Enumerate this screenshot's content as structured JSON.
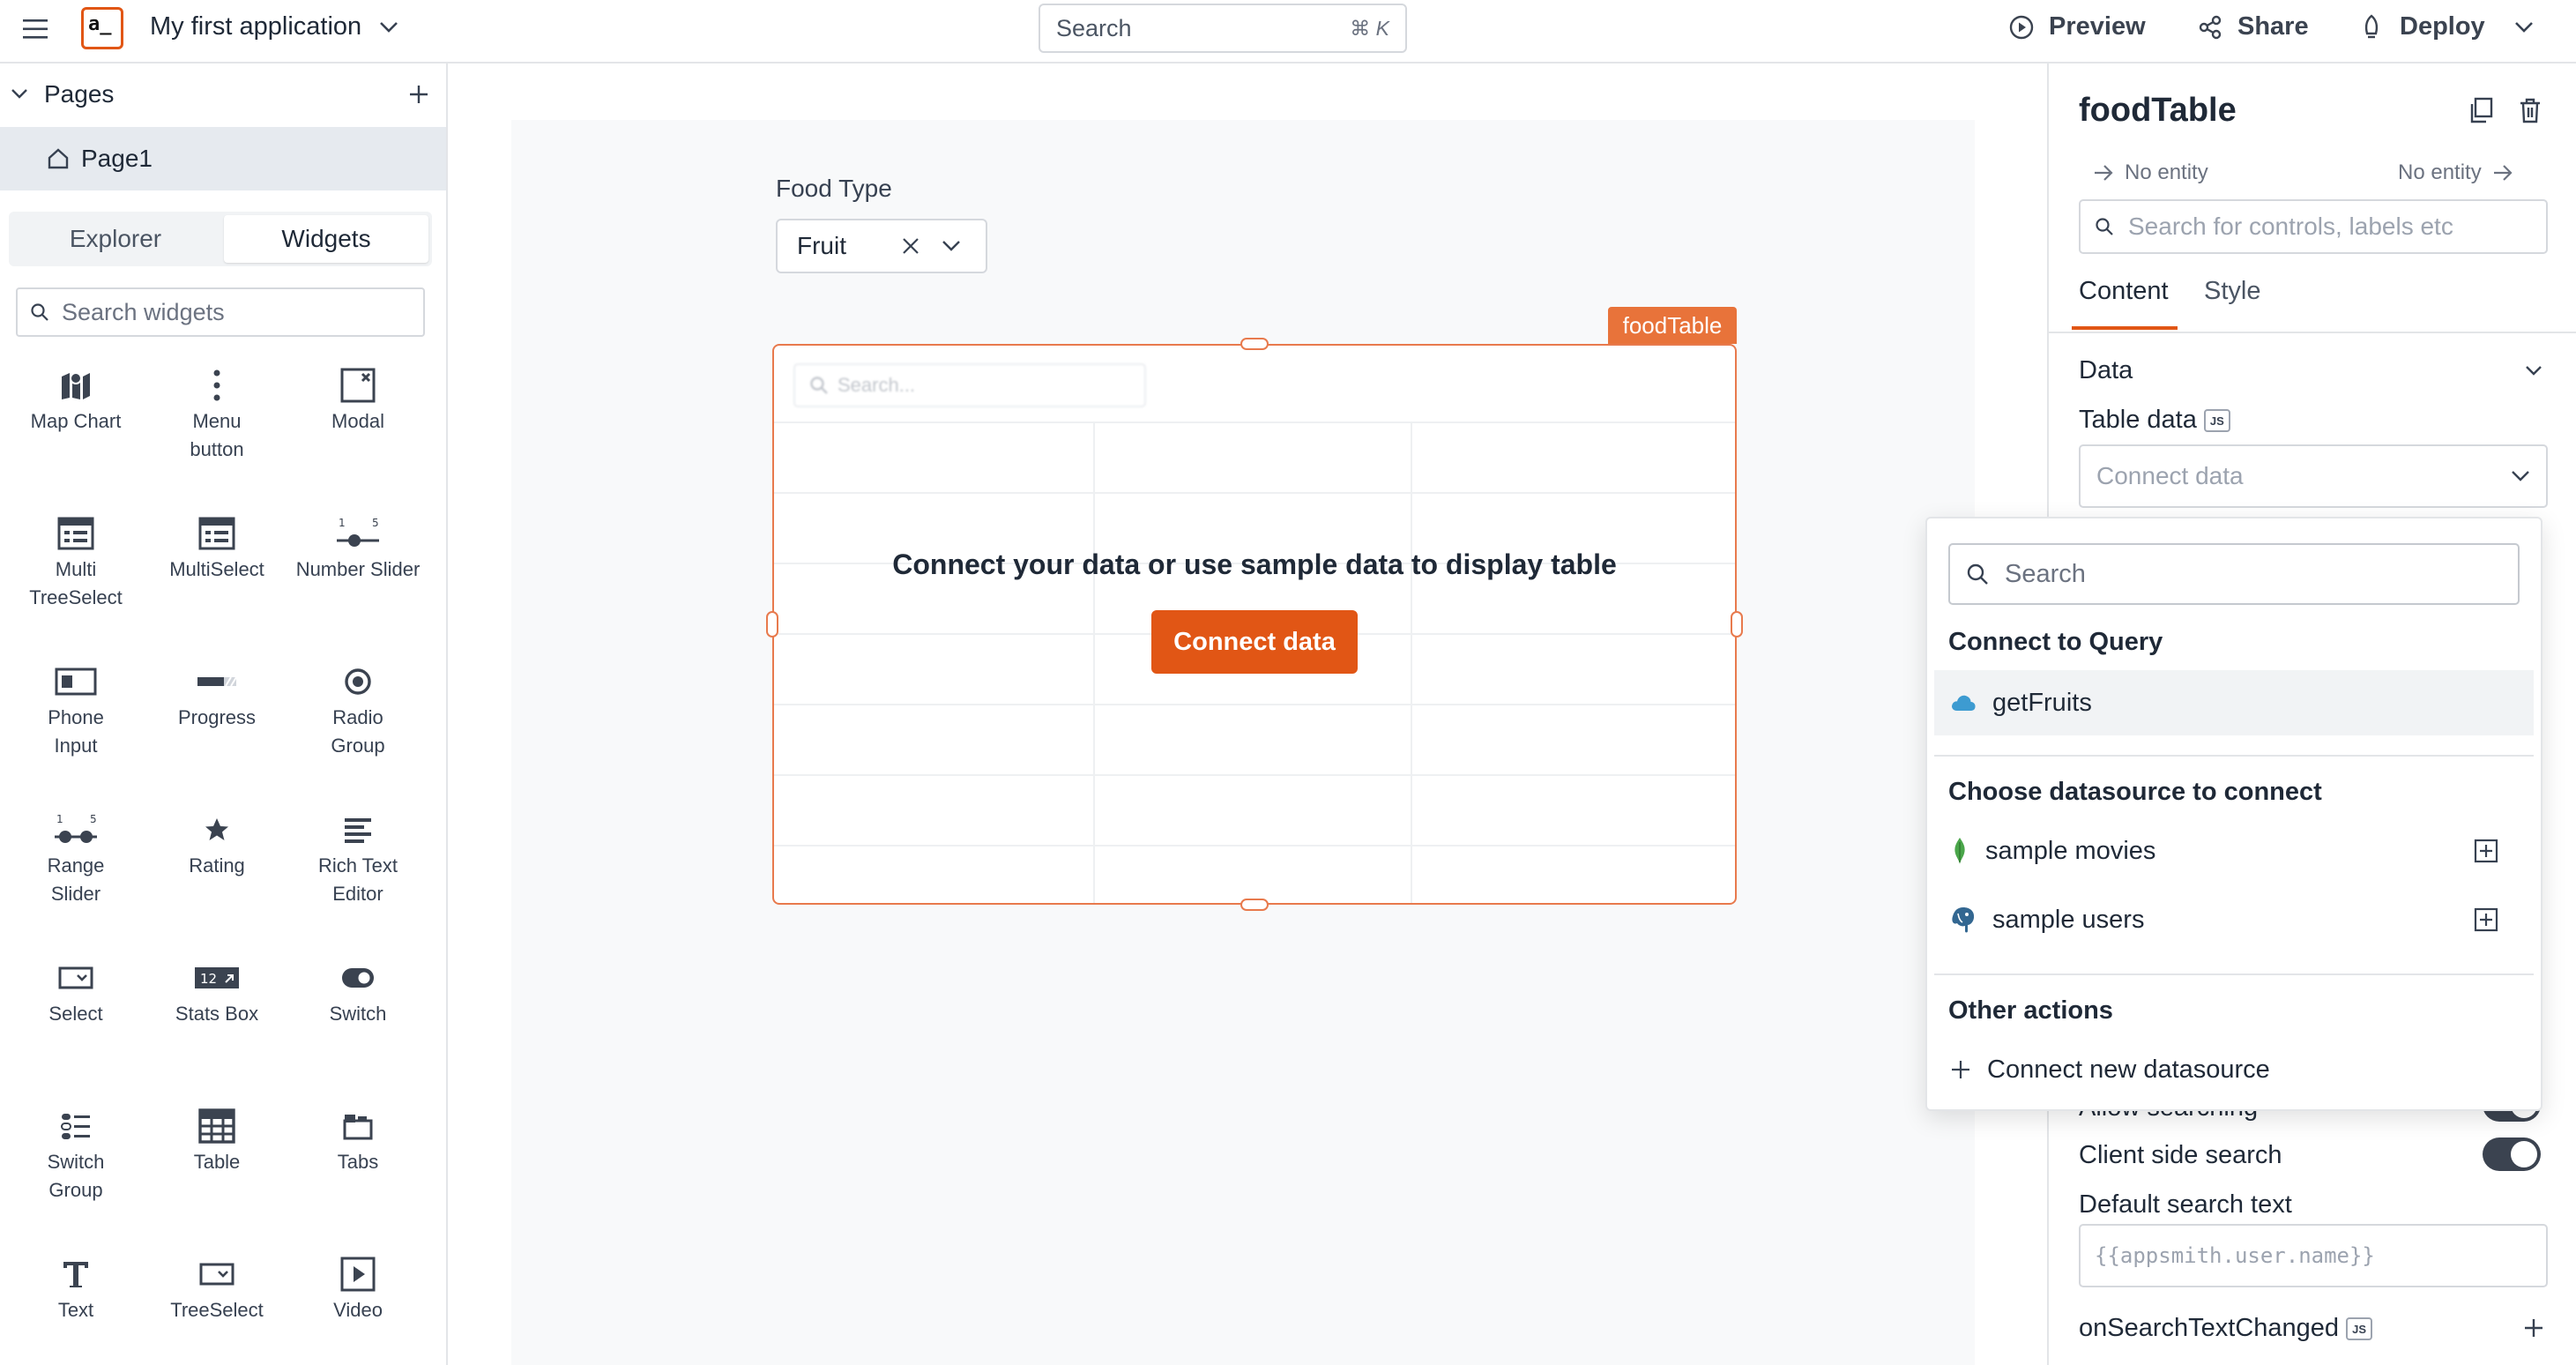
{
  "header": {
    "app_name": "My first application",
    "search_placeholder": "Search",
    "search_shortcut": "⌘ K",
    "preview_label": "Preview",
    "share_label": "Share",
    "deploy_label": "Deploy",
    "logo_text": "a_"
  },
  "sidebar": {
    "pages_title": "Pages",
    "pages": [
      {
        "label": "Page1"
      }
    ],
    "tabs": [
      {
        "label": "Explorer"
      },
      {
        "label": "Widgets"
      }
    ],
    "active_tab": "Widgets",
    "search_placeholder": "Search widgets",
    "widgets": [
      {
        "label": "Map Chart",
        "icon": "map-chart-icon"
      },
      {
        "label": "Menu button",
        "icon": "menu-button-icon"
      },
      {
        "label": "Modal",
        "icon": "modal-icon"
      },
      {
        "label": "Multi TreeSelect",
        "icon": "multi-treeselect-icon"
      },
      {
        "label": "MultiSelect",
        "icon": "multiselect-icon"
      },
      {
        "label": "Number Slider",
        "icon": "number-slider-icon"
      },
      {
        "label": "Phone Input",
        "icon": "phone-input-icon"
      },
      {
        "label": "Progress",
        "icon": "progress-icon"
      },
      {
        "label": "Radio Group",
        "icon": "radio-group-icon"
      },
      {
        "label": "Range Slider",
        "icon": "range-slider-icon"
      },
      {
        "label": "Rating",
        "icon": "rating-icon"
      },
      {
        "label": "Rich Text Editor",
        "icon": "rich-text-editor-icon"
      },
      {
        "label": "Select",
        "icon": "select-icon"
      },
      {
        "label": "Stats Box",
        "icon": "stats-box-icon"
      },
      {
        "label": "Switch",
        "icon": "switch-icon"
      },
      {
        "label": "Switch Group",
        "icon": "switch-group-icon"
      },
      {
        "label": "Table",
        "icon": "table-icon"
      },
      {
        "label": "Tabs",
        "icon": "tabs-icon"
      },
      {
        "label": "Text",
        "icon": "text-icon"
      },
      {
        "label": "TreeSelect",
        "icon": "treeselect-icon"
      },
      {
        "label": "Video",
        "icon": "video-icon"
      }
    ],
    "slider_min": "1",
    "slider_max": "5",
    "stats_value": "12"
  },
  "canvas": {
    "food_type_label": "Food Type",
    "food_type_value": "Fruit",
    "table_name": "foodTable",
    "table_search_placeholder": "Search...",
    "empty_message": "Connect your data or use sample data to display table",
    "connect_button": "Connect data"
  },
  "properties": {
    "widget_name": "foodTable",
    "entity_left": "No entity",
    "entity_right": "No entity",
    "search_placeholder": "Search for controls, labels etc",
    "tabs": [
      {
        "label": "Content"
      },
      {
        "label": "Style"
      }
    ],
    "active_tab": "Content",
    "section_data": "Data",
    "table_data_label": "Table data",
    "js_badge": "JS",
    "table_data_placeholder": "Connect data",
    "allow_searching_label": "Allow searching",
    "allow_searching_on": true,
    "client_side_search_label": "Client side search",
    "client_side_search_on": true,
    "default_search_text_label": "Default search text",
    "default_search_text_placeholder": "{{appsmith.user.name}}",
    "on_search_text_changed_label": "onSearchTextChanged"
  },
  "dropdown": {
    "search_placeholder": "Search",
    "query_heading": "Connect to Query",
    "queries": [
      {
        "label": "getFruits",
        "icon": "cloud-icon"
      }
    ],
    "datasource_heading": "Choose datasource to connect",
    "datasources": [
      {
        "label": "sample movies",
        "icon": "mongodb-icon"
      },
      {
        "label": "sample users",
        "icon": "postgres-icon"
      }
    ],
    "other_heading": "Other actions",
    "other_actions": [
      {
        "label": "Connect new datasource",
        "icon": "plus-icon"
      }
    ]
  },
  "colors": {
    "accent": "#e15615",
    "table_border": "#e87a4d",
    "toggle_on": "#3b4350"
  }
}
